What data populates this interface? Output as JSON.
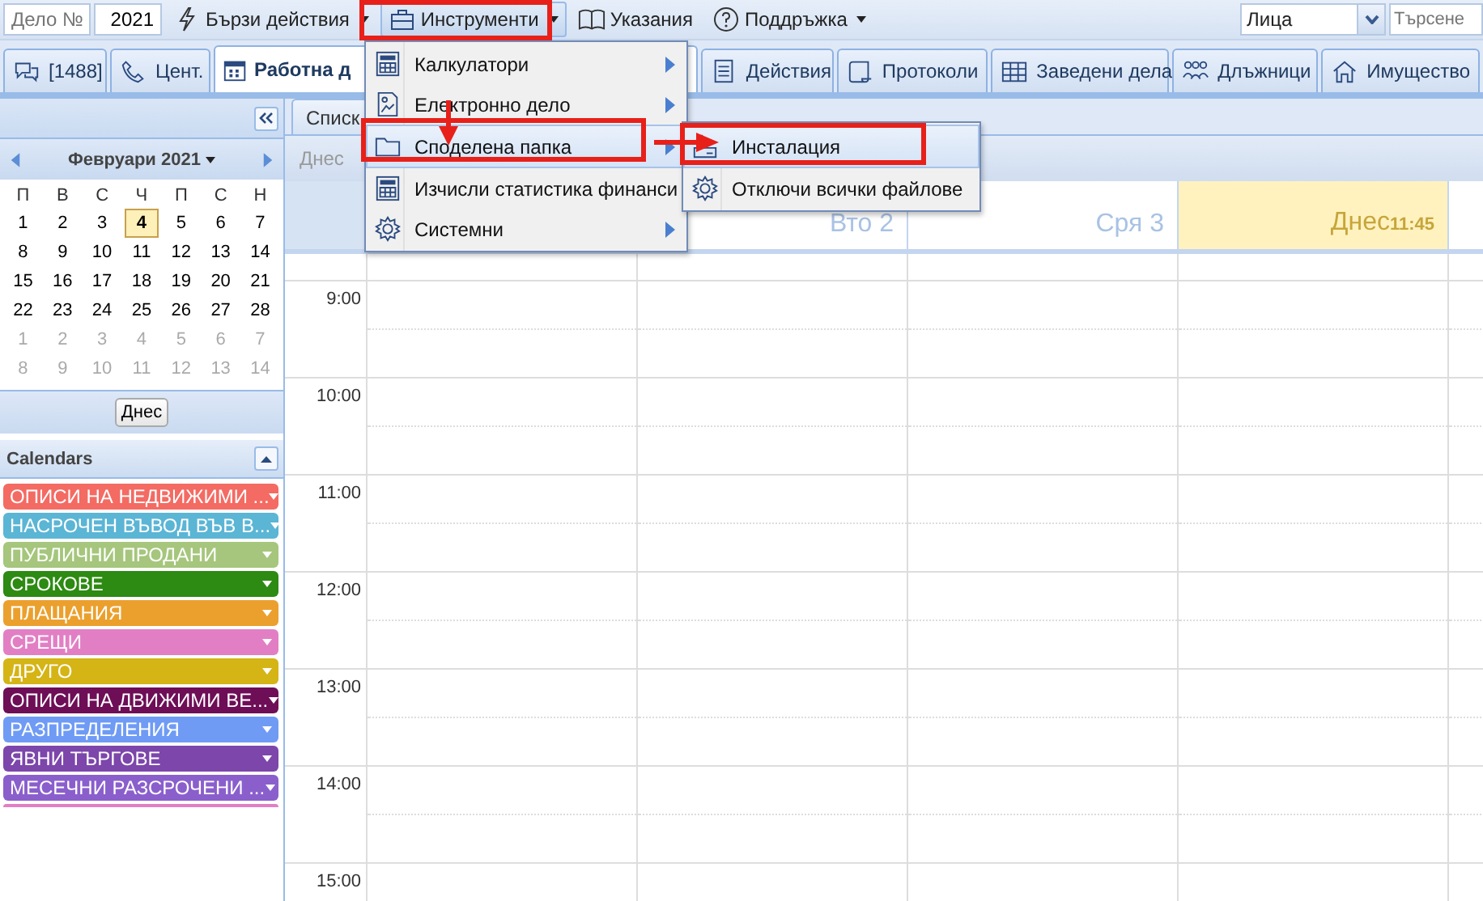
{
  "toolbar": {
    "case_field": {
      "placeholder": "Дело №"
    },
    "year_field": {
      "value": "2021"
    },
    "buttons": [
      {
        "label": "Бързи действия",
        "dropdown": true,
        "selected": false
      },
      {
        "label": "Инструменти",
        "dropdown": true,
        "selected": true
      },
      {
        "label": "Указания",
        "dropdown": false,
        "selected": false
      },
      {
        "label": "Поддръжка",
        "dropdown": true,
        "selected": false
      }
    ],
    "type_select": {
      "value": "Лица"
    },
    "search": {
      "placeholder": "Търсене"
    }
  },
  "tabs": [
    {
      "label": "[1488]",
      "selected": false
    },
    {
      "label": "Цент.",
      "selected": false
    },
    {
      "label": "Работна д",
      "selected": true
    },
    {
      "label": "Действия",
      "selected": false
    },
    {
      "label": "Протоколи",
      "selected": false
    },
    {
      "label": "Заведени дела",
      "selected": false
    },
    {
      "label": "Длъжници",
      "selected": false
    },
    {
      "label": "Имущество",
      "selected": false
    }
  ],
  "tools_menu": {
    "items": [
      {
        "label": "Калкулатори",
        "submenu": true,
        "selected": false
      },
      {
        "label": "Електронно дело",
        "submenu": true,
        "selected": false
      },
      {
        "label": "Споделена папка",
        "submenu": true,
        "selected": true
      },
      {
        "label": "Изчисли статистика финанси",
        "submenu": false,
        "selected": false
      },
      {
        "label": "Системни",
        "submenu": true,
        "selected": false
      }
    ],
    "submenu": [
      {
        "label": "Инсталация",
        "selected": true
      },
      {
        "label": "Отключи всички файлове",
        "selected": false
      }
    ]
  },
  "mini_calendar": {
    "month": "Февруари 2021",
    "weekdays": [
      "П",
      "В",
      "С",
      "Ч",
      "П",
      "С",
      "Н"
    ],
    "weeks": [
      [
        {
          "day": "1",
          "other_month": false,
          "selected": false
        },
        {
          "day": "2",
          "other_month": false,
          "selected": false
        },
        {
          "day": "3",
          "other_month": false,
          "selected": false
        },
        {
          "day": "4",
          "other_month": false,
          "selected": true
        },
        {
          "day": "5",
          "other_month": false,
          "selected": false
        },
        {
          "day": "6",
          "other_month": false,
          "selected": false
        },
        {
          "day": "7",
          "other_month": false,
          "selected": false
        }
      ],
      [
        {
          "day": "8",
          "other_month": false,
          "selected": false
        },
        {
          "day": "9",
          "other_month": false,
          "selected": false
        },
        {
          "day": "10",
          "other_month": false,
          "selected": false
        },
        {
          "day": "11",
          "other_month": false,
          "selected": false
        },
        {
          "day": "12",
          "other_month": false,
          "selected": false
        },
        {
          "day": "13",
          "other_month": false,
          "selected": false
        },
        {
          "day": "14",
          "other_month": false,
          "selected": false
        }
      ],
      [
        {
          "day": "15",
          "other_month": false,
          "selected": false
        },
        {
          "day": "16",
          "other_month": false,
          "selected": false
        },
        {
          "day": "17",
          "other_month": false,
          "selected": false
        },
        {
          "day": "18",
          "other_month": false,
          "selected": false
        },
        {
          "day": "19",
          "other_month": false,
          "selected": false
        },
        {
          "day": "20",
          "other_month": false,
          "selected": false
        },
        {
          "day": "21",
          "other_month": false,
          "selected": false
        }
      ],
      [
        {
          "day": "22",
          "other_month": false,
          "selected": false
        },
        {
          "day": "23",
          "other_month": false,
          "selected": false
        },
        {
          "day": "24",
          "other_month": false,
          "selected": false
        },
        {
          "day": "25",
          "other_month": false,
          "selected": false
        },
        {
          "day": "26",
          "other_month": false,
          "selected": false
        },
        {
          "day": "27",
          "other_month": false,
          "selected": false
        },
        {
          "day": "28",
          "other_month": false,
          "selected": false
        }
      ],
      [
        {
          "day": "1",
          "other_month": true,
          "selected": false
        },
        {
          "day": "2",
          "other_month": true,
          "selected": false
        },
        {
          "day": "3",
          "other_month": true,
          "selected": false
        },
        {
          "day": "4",
          "other_month": true,
          "selected": false
        },
        {
          "day": "5",
          "other_month": true,
          "selected": false
        },
        {
          "day": "6",
          "other_month": true,
          "selected": false
        },
        {
          "day": "7",
          "other_month": true,
          "selected": false
        }
      ],
      [
        {
          "day": "8",
          "other_month": true,
          "selected": false
        },
        {
          "day": "9",
          "other_month": true,
          "selected": false
        },
        {
          "day": "10",
          "other_month": true,
          "selected": false
        },
        {
          "day": "11",
          "other_month": true,
          "selected": false
        },
        {
          "day": "12",
          "other_month": true,
          "selected": false
        },
        {
          "day": "13",
          "other_month": true,
          "selected": false
        },
        {
          "day": "14",
          "other_month": true,
          "selected": false
        }
      ]
    ],
    "today_button": "Днес"
  },
  "calendars": {
    "title": "Calendars",
    "items": [
      {
        "label": "ОПИСИ НА НЕДВИЖИМИ ...",
        "color": "#f36b63"
      },
      {
        "label": "НАСРОЧЕН ВЪВОД ВЪВ В...",
        "color": "#5bb5d5"
      },
      {
        "label": "ПУБЛИЧНИ ПРОДАНИ",
        "color": "#a5c67c"
      },
      {
        "label": "СРОКОВЕ",
        "color": "#2d8a12"
      },
      {
        "label": "ПЛАЩАНИЯ",
        "color": "#eba02d"
      },
      {
        "label": "СРЕЩИ",
        "color": "#e27fc4"
      },
      {
        "label": "ДРУГО",
        "color": "#d5b416"
      },
      {
        "label": "ОПИСИ НА ДВИЖИМИ ВЕ...",
        "color": "#6e0e57"
      },
      {
        "label": "РАЗПРЕДЕЛЕНИЯ",
        "color": "#6f9bf5"
      },
      {
        "label": "ЯВНИ ТЪРГОВЕ",
        "color": "#7c46ab"
      },
      {
        "label": "МЕСЕЧНИ РАЗСРОЧЕНИ ...",
        "color": "#8a5fcc"
      }
    ]
  },
  "main": {
    "tab": "Списк",
    "today_button": "Днес",
    "days": [
      {
        "label": "Вто 2",
        "today": false
      },
      {
        "label": "Сря 3",
        "today": false
      },
      {
        "label": "Днес",
        "time": "11:45",
        "today": true
      },
      {
        "today": false
      }
    ],
    "hours": [
      "9:00",
      "10:00",
      "11:00",
      "12:00",
      "13:00",
      "14:00",
      "15:00"
    ]
  }
}
